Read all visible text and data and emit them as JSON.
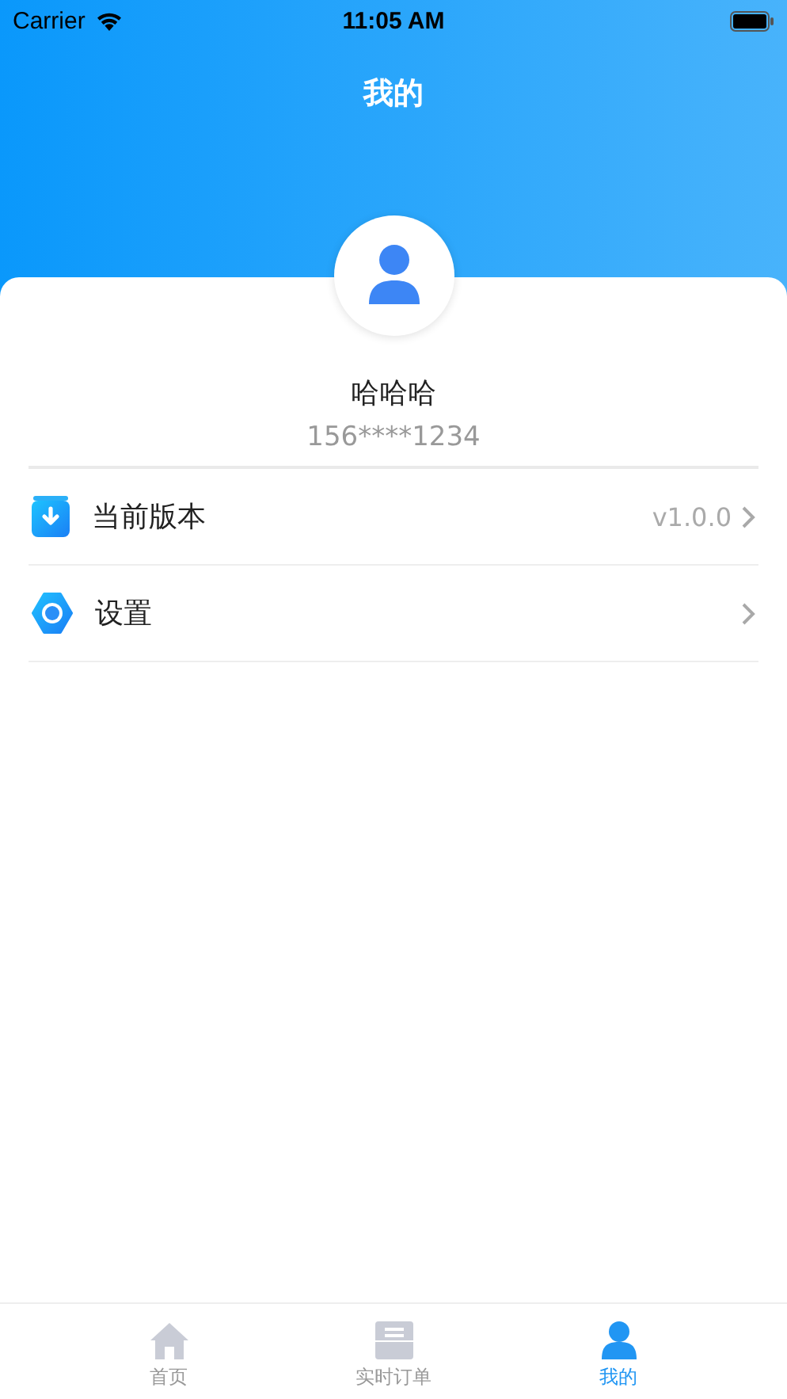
{
  "status_bar": {
    "carrier": "Carrier",
    "time": "11:05 AM"
  },
  "header": {
    "title": "我的"
  },
  "profile": {
    "name": "哈哈哈",
    "phone": "156****1234"
  },
  "menu": [
    {
      "kind": "version",
      "label": "当前版本",
      "value": "v1.0.0"
    },
    {
      "kind": "settings",
      "label": "设置"
    }
  ],
  "tab_bar": [
    {
      "kind": "home",
      "label": "首页",
      "selected": false
    },
    {
      "kind": "orders",
      "label": "实时订单",
      "selected": false
    },
    {
      "kind": "profile",
      "label": "我的",
      "selected": true
    }
  ]
}
